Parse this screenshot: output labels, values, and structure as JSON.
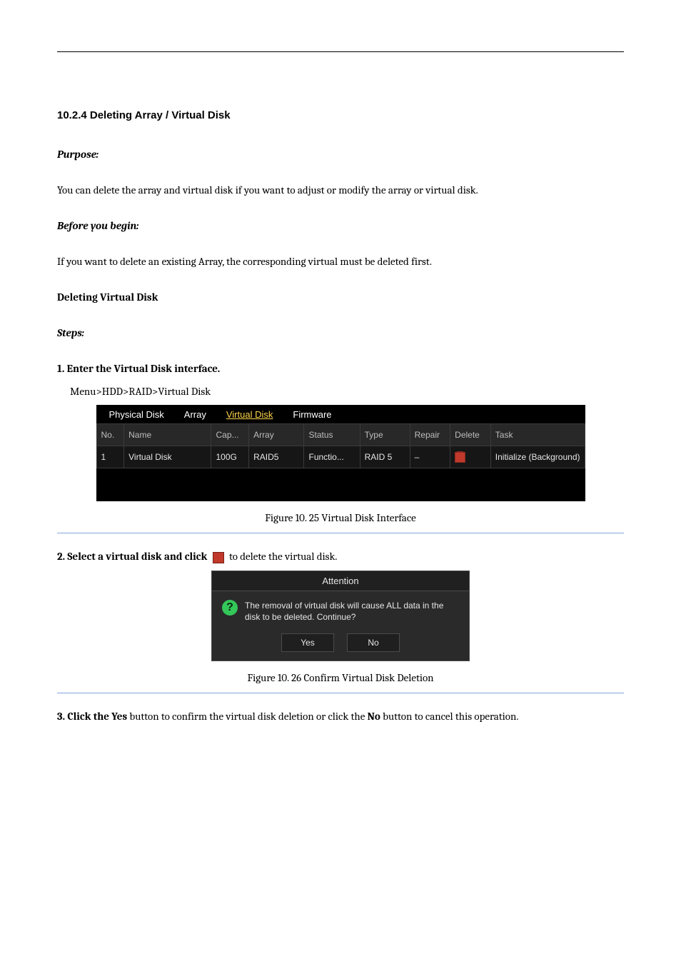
{
  "headings": {
    "deleting_heading": "10.2.4 Deleting Array / Virtual Disk"
  },
  "intro": {
    "purpose_label": "Purpose:",
    "before_label": "Before you begin:",
    "steps_label": "Steps:",
    "purpose_text": "You can delete the array and virtual disk if you want to adjust or modify the array or virtual disk.",
    "before_text": "If you want to delete an existing Array, the corresponding virtual must be deleted first.",
    "intro_line": "Deleting Virtual Disk"
  },
  "steps": {
    "step1": "1. Enter the Virtual Disk interface.",
    "step1_path": "Menu>HDD>RAID>Virtual Disk",
    "step2": "2. Select a virtual disk and click",
    "step2_tail": "to delete the virtual disk.",
    "step3_a": "3. Click the ",
    "step3_yes": "Yes",
    "step3_b": " button to confirm the virtual disk deletion or click the ",
    "step3_no": "No",
    "step3_c": " button to cancel this operation."
  },
  "captions": {
    "fig1": "Figure 10. 25 Virtual Disk Interface",
    "fig2": "Figure 10. 26 Confirm Virtual Disk Deletion"
  },
  "vd_screenshot": {
    "tabs": {
      "physical": "Physical Disk",
      "array": "Array",
      "virtual": "Virtual Disk",
      "firmware": "Firmware"
    },
    "headers": {
      "no": "No.",
      "name": "Name",
      "cap": "Cap...",
      "array": "Array",
      "status": "Status",
      "type": "Type",
      "repair": "Repair",
      "delete": "Delete",
      "task": "Task"
    },
    "row": {
      "no": "1",
      "name": "Virtual Disk",
      "cap": "100G",
      "array": "RAID5",
      "status": "Functio...",
      "type": "RAID 5",
      "repair": "–",
      "task": "Initialize (Background)"
    }
  },
  "attention": {
    "title": "Attention",
    "message": "The removal of virtual disk will cause ALL data in the disk to be deleted. Continue?",
    "yes": "Yes",
    "no": "No"
  }
}
